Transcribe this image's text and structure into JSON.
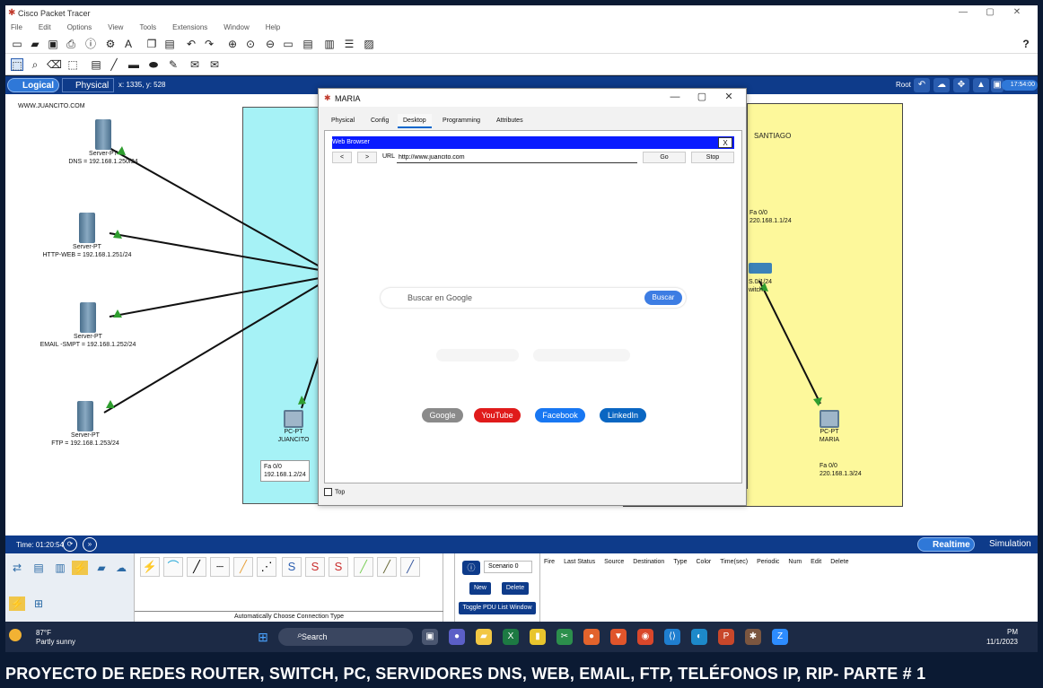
{
  "app": {
    "title": "Cisco Packet Tracer",
    "menu": [
      "File",
      "Edit",
      "Options",
      "View",
      "Tools",
      "Extensions",
      "Window",
      "Help"
    ],
    "help_glyph": "?"
  },
  "mode": {
    "logical": "Logical",
    "physical": "Physical",
    "coords": "x: 1335, y: 528",
    "root": "Root",
    "clock": "17:54:00"
  },
  "workspace": {
    "domain_label": "WWW.JUANCITO.COM",
    "servers": [
      {
        "name": "Server-PT",
        "label": "DNS = 192.168.1.250/24"
      },
      {
        "name": "Server-PT",
        "label": "HTTP-WEB = 192.168.1.251/24"
      },
      {
        "name": "Server-PT",
        "label": "EMAIL -SMPT = 192.168.1.252/24"
      },
      {
        "name": "Server-PT",
        "label": "FTP = 192.168.1.253/24"
      }
    ],
    "pc_juancito": {
      "type": "PC-PT",
      "name": "JUANCITO",
      "iface": "Fa 0/0",
      "ip": "192.168.1.2/24"
    },
    "pc_maria": {
      "type": "PC-PT",
      "name": "MARIA",
      "iface": "Fa 0/0",
      "ip": "220.168.1.3/24"
    },
    "santiago": "SANTIAGO",
    "router_iface": "Fa 0/0",
    "router_ip": "220.168.1.1/24",
    "switch_partial": "S.0/1/24",
    "switch_partial2": "witch"
  },
  "dialog": {
    "title": "MARIA",
    "tabs": [
      "Physical",
      "Config",
      "Desktop",
      "Programming",
      "Attributes"
    ],
    "active_tab": "Desktop",
    "browser_title": "Web Browser",
    "close": "X",
    "back": "<",
    "forward": ">",
    "url_label": "URL",
    "url_value": "http://www.juancito.com",
    "go": "Go",
    "stop": "Stop",
    "search_placeholder": "Buscar en Google",
    "search_button": "Buscar",
    "links": [
      "Google",
      "YouTube",
      "Facebook",
      "LinkedIn"
    ],
    "top_label": "Top"
  },
  "timebar": {
    "time": "Time: 01:20:54",
    "realtime": "Realtime",
    "simulation": "Simulation"
  },
  "bottom": {
    "auto_conn": "Automatically Choose Connection Type",
    "scenario": "Scenario 0",
    "new": "New",
    "delete": "Delete",
    "toggle": "Toggle PDU List Window",
    "pdu_columns": [
      "Fire",
      "Last Status",
      "Source",
      "Destination",
      "Type",
      "Color",
      "Time(sec)",
      "Periodic",
      "Num",
      "Edit",
      "Delete"
    ]
  },
  "taskbar": {
    "temp": "87°F",
    "weather": "Partly sunny",
    "search": "Search",
    "time": "PM",
    "date": "11/1/2023"
  },
  "caption": "PROYECTO DE REDES ROUTER, SWITCH, PC, SERVIDORES DNS, WEB, EMAIL, FTP, TELÉFONOS IP, RIP- PARTE # 1",
  "colors": {
    "mode_bar": "#0e3b8a",
    "web_browser_bar": "#0a1bff",
    "youtube": "#e01b1b",
    "facebook": "#1877f2",
    "linkedin": "#0a66c2",
    "google": "#8a8a8a",
    "zone_cyan": "#a6f2f6",
    "zone_yellow": "#fdf89b"
  }
}
